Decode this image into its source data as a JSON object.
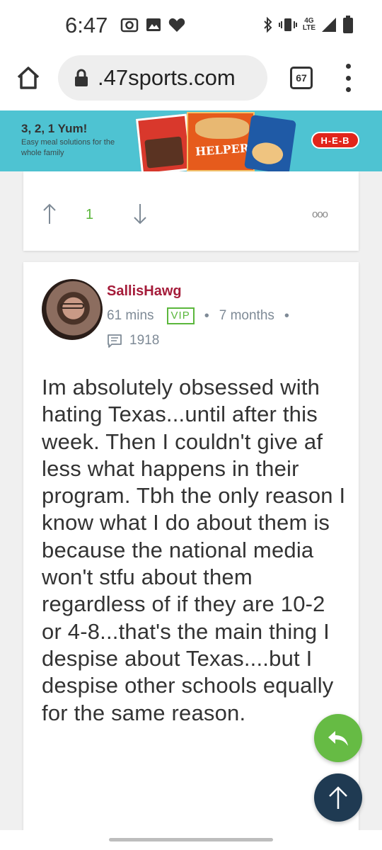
{
  "status_bar": {
    "time": "6:47",
    "network_label_top": "4G",
    "network_label_bottom": "LTE"
  },
  "browser": {
    "url": ".47sports.com",
    "tab_count": "67"
  },
  "ad": {
    "headline": "3, 2, 1 Yum!",
    "subline": "Easy meal solutions for the whole family",
    "product_label": "HELPER",
    "brand": "H-E-B"
  },
  "previous_post": {
    "vote_count": "1",
    "more_label": "ooo"
  },
  "post": {
    "username": "SallisHawg",
    "time_ago": "61 mins",
    "badge": "VIP",
    "member_since": "7 months",
    "post_count": "1918",
    "body": "Im absolutely obsessed with hating Texas...until after this week. Then I couldn't give af less what happens in their program. Tbh the only reason I know what I do about them is because the national media won't stfu about them regardless of if they are 10-2 or 4-8...that's the main thing I despise about Texas....but I despise other schools equally for the same reason."
  },
  "colors": {
    "username": "#a51c3a",
    "vip": "#5bb73c",
    "reply_fab": "#66bb44",
    "top_fab": "#1f3a52",
    "ad_bg": "#4ec3d2"
  },
  "icons": {
    "camera": "camera-icon",
    "image": "image-icon",
    "heart": "heart-icon",
    "bluetooth": "bluetooth-icon",
    "vibrate": "vibrate-icon",
    "signal": "signal-icon",
    "battery": "battery-icon",
    "home": "home-icon",
    "lock": "lock-icon",
    "menu": "more-vert-icon",
    "upvote": "arrow-up-icon",
    "downvote": "arrow-down-icon",
    "posts": "message-icon",
    "reply": "reply-icon",
    "scroll_top": "arrow-up-icon"
  }
}
